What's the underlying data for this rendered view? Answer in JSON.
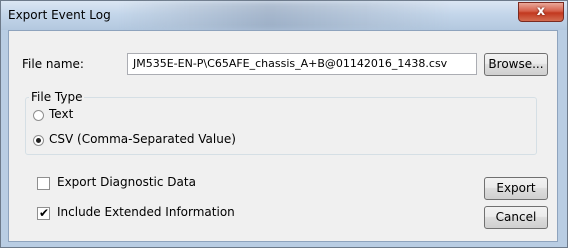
{
  "window": {
    "title": "Export Event Log",
    "close_glyph": "x"
  },
  "file": {
    "label": "File name:",
    "value": "JM535E-EN-P\\C65AFE_chassis_A+B@01142016_1438.csv",
    "browse_label": "Browse..."
  },
  "file_type": {
    "legend": "File Type",
    "options": [
      {
        "label": "Text",
        "selected": false
      },
      {
        "label": "CSV (Comma-Separated Value)",
        "selected": true
      }
    ]
  },
  "options": {
    "export_diagnostic": {
      "label": "Export Diagnostic Data",
      "checked": false
    },
    "include_extended": {
      "label": "Include Extended Information",
      "checked": true
    }
  },
  "buttons": {
    "export": "Export",
    "cancel": "Cancel"
  },
  "icons": {
    "close": "close-icon",
    "check": "check-icon"
  }
}
